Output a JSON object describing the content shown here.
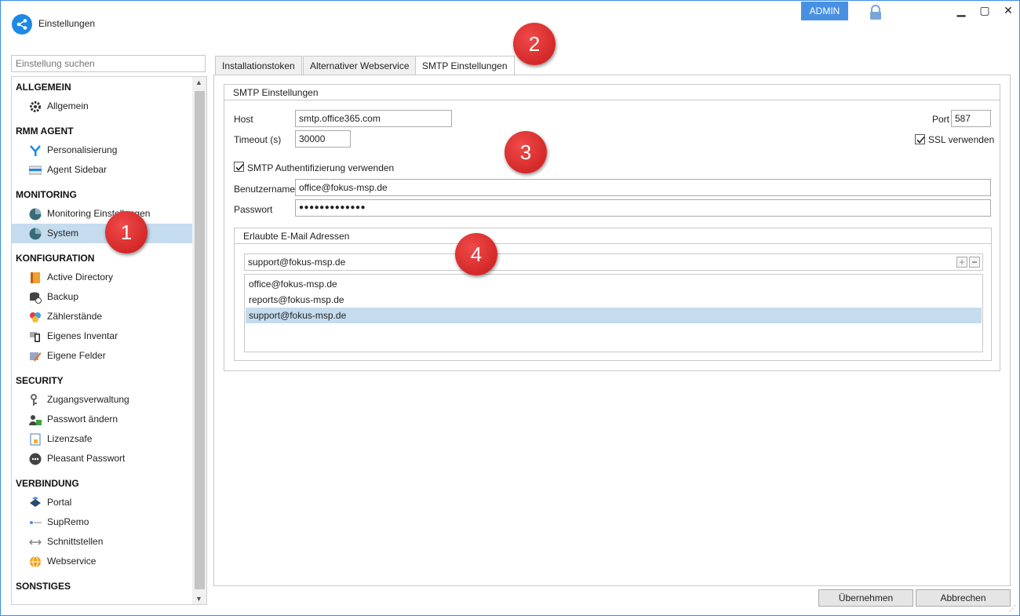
{
  "app": {
    "title": "Einstellungen",
    "admin_label": "ADMIN"
  },
  "colors": {
    "accent": "#4a90e2",
    "selection": "#c5dcef",
    "callout": "#d62828"
  },
  "search": {
    "placeholder": "Einstellung suchen"
  },
  "sidebar": {
    "sections": [
      {
        "title": "ALLGEMEIN"
      },
      {
        "title": "RMM AGENT"
      },
      {
        "title": "MONITORING"
      },
      {
        "title": "KONFIGURATION"
      },
      {
        "title": "SECURITY"
      },
      {
        "title": "VERBINDUNG"
      },
      {
        "title": "SONSTIGES"
      }
    ],
    "items": [
      {
        "label": "Allgemein",
        "icon": "gear-icon"
      },
      {
        "label": "Personalisierung",
        "icon": "brush-icon"
      },
      {
        "label": "Agent Sidebar",
        "icon": "sidebar-icon"
      },
      {
        "label": "Monitoring Einstellungen",
        "icon": "monitoring-icon"
      },
      {
        "label": "System",
        "icon": "monitoring-icon",
        "selected": true
      },
      {
        "label": "Active Directory",
        "icon": "directory-icon"
      },
      {
        "label": "Backup",
        "icon": "backup-icon"
      },
      {
        "label": "Zählerstände",
        "icon": "counter-icon"
      },
      {
        "label": "Eigenes Inventar",
        "icon": "inventory-icon"
      },
      {
        "label": "Eigene Felder",
        "icon": "fields-icon"
      },
      {
        "label": "Zugangsverwaltung",
        "icon": "key-icon"
      },
      {
        "label": "Passwort ändern",
        "icon": "user-lock-icon"
      },
      {
        "label": "Lizenzsafe",
        "icon": "license-icon"
      },
      {
        "label": "Pleasant Passwort",
        "icon": "password-icon"
      },
      {
        "label": "Portal",
        "icon": "portal-icon"
      },
      {
        "label": "SupRemo",
        "icon": "remote-icon"
      },
      {
        "label": "Schnittstellen",
        "icon": "interface-icon"
      },
      {
        "label": "Webservice",
        "icon": "globe-icon"
      }
    ]
  },
  "tabs": [
    {
      "label": "Installationstoken"
    },
    {
      "label": "Alternativer Webservice"
    },
    {
      "label": "SMTP Einstellungen",
      "active": true
    }
  ],
  "smtp": {
    "group_title": "SMTP Einstellungen",
    "host_label": "Host",
    "host_value": "smtp.office365.com",
    "timeout_label": "Timeout (s)",
    "timeout_value": "30000",
    "port_label": "Port",
    "port_value": "587",
    "ssl_label": "SSL verwenden",
    "ssl_checked": true,
    "auth_label": "SMTP Authentifizierung verwenden",
    "auth_checked": true,
    "username_label": "Benutzername",
    "username_value": "office@fokus-msp.de",
    "password_label": "Passwort",
    "password_value": "●●●●●●●●●●●●●"
  },
  "emails": {
    "group_title": "Erlaubte E-Mail Adressen",
    "input_value": "support@fokus-msp.de",
    "add_label": "+",
    "remove_label": "−",
    "list": [
      {
        "value": "office@fokus-msp.de"
      },
      {
        "value": "reports@fokus-msp.de"
      },
      {
        "value": "support@fokus-msp.de",
        "selected": true
      }
    ]
  },
  "footer": {
    "apply_label": "Übernehmen",
    "cancel_label": "Abbrechen"
  },
  "callouts": [
    "1",
    "2",
    "3",
    "4"
  ]
}
